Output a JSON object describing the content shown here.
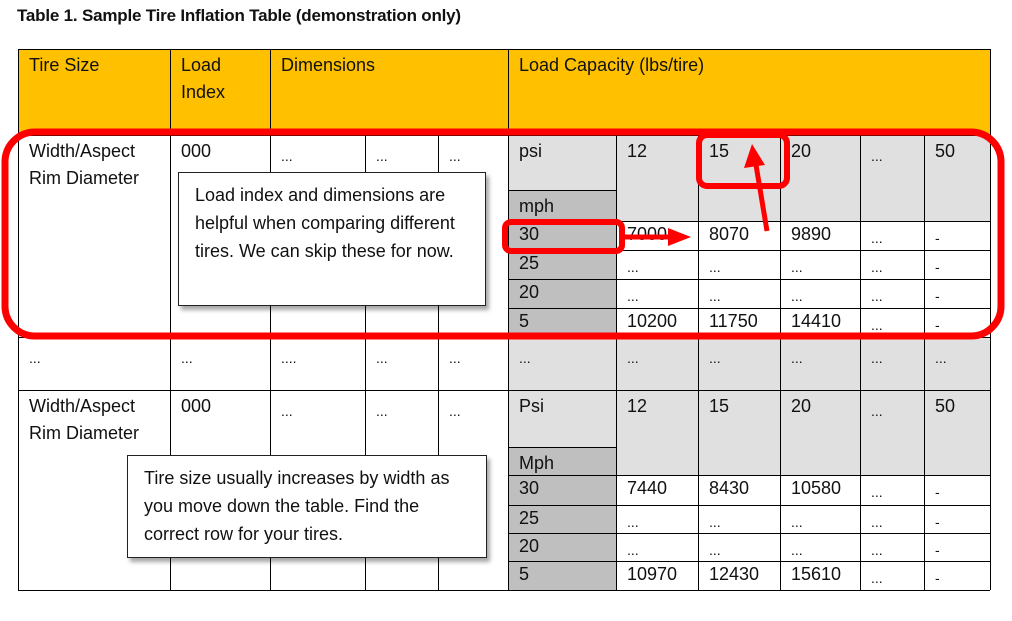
{
  "caption": "Table 1. Sample Tire Inflation Table (demonstration only)",
  "header": {
    "tire_size": "Tire Size",
    "load_index_line1": "Load",
    "load_index_line2": "Index",
    "dimensions": "Dimensions",
    "load_capacity": "Load Capacity (lbs/tire)"
  },
  "groups": [
    {
      "tire_size_line1": "Width/Aspect",
      "tire_size_line2": "Rim Diameter",
      "load_index": "000",
      "dims": [
        "...",
        "...",
        "..."
      ],
      "psi_label": "psi",
      "mph_label": "mph",
      "psi_values": [
        "12",
        "15",
        "20",
        "...",
        "50"
      ],
      "rows": [
        {
          "mph": "30",
          "values": [
            "7000",
            "8070",
            "9890",
            "...",
            "-"
          ]
        },
        {
          "mph": "25",
          "values": [
            "...",
            "...",
            "...",
            "...",
            "-"
          ]
        },
        {
          "mph": "20",
          "values": [
            "...",
            "...",
            "...",
            "...",
            "-"
          ]
        },
        {
          "mph": "5",
          "values": [
            "10200",
            "11750",
            "14410",
            "...",
            "-"
          ]
        }
      ]
    },
    {
      "tire_size_line1": "Width/Aspect",
      "tire_size_line2": "Rim Diameter",
      "load_index": "000",
      "dims": [
        "...",
        "...",
        "..."
      ],
      "psi_label": "Psi",
      "mph_label": "Mph",
      "psi_values": [
        "12",
        "15",
        "20",
        "...",
        "50"
      ],
      "rows": [
        {
          "mph": "30",
          "values": [
            "7440",
            "8430",
            "10580",
            "...",
            "-"
          ]
        },
        {
          "mph": "25",
          "values": [
            "...",
            "...",
            "...",
            "...",
            "-"
          ]
        },
        {
          "mph": "20",
          "values": [
            "...",
            "...",
            "...",
            "...",
            "-"
          ]
        },
        {
          "mph": "5",
          "values": [
            "10970",
            "12430",
            "15610",
            "...",
            "-"
          ]
        }
      ]
    }
  ],
  "ellipsis_row": [
    "...",
    "...",
    "....",
    "...",
    "...",
    "...",
    "...",
    "...",
    "...",
    "...",
    "..."
  ],
  "callouts": {
    "first": "Load index and dimensions are helpful when comparing different tires. We can skip these for now.",
    "second": "Tire size usually increases by width as you move down the table. Find the correct row for your tires."
  },
  "colors": {
    "header": "#ffc000",
    "annotation_red": "#ff0000",
    "psi_gray": "#e0e0e0",
    "mph_gray": "#bfbfbf"
  }
}
